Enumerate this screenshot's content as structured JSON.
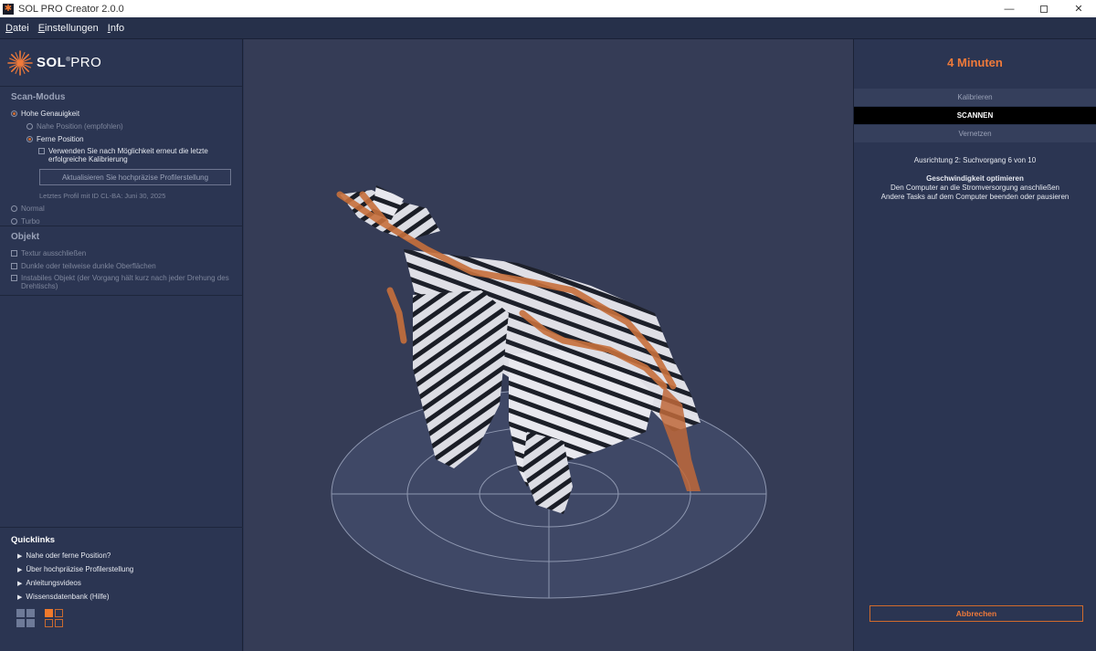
{
  "window": {
    "title": "SOL PRO Creator 2.0.0",
    "minimize": "—",
    "close": "✕"
  },
  "menu": [
    {
      "first": "D",
      "rest": "atei"
    },
    {
      "first": "E",
      "rest": "instellungen"
    },
    {
      "first": "I",
      "rest": "nfo"
    }
  ],
  "logo": {
    "sol": "SOL",
    "reg": "®",
    "pro": "PRO"
  },
  "scan_mode": {
    "heading": "Scan-Modus",
    "high_accuracy": "Hohe Genauigkeit",
    "near_position": "Nahe Position (empfohlen)",
    "far_position": "Ferne Position",
    "reuse_calibration": "Verwenden Sie nach Möglichkeit erneut die letzte erfolgreiche Kalibrierung",
    "update_profile_button": "Aktualisieren Sie hochpräzise Profilerstellung",
    "last_profile": "Letztes Profil mit ID CL-BA: Juni 30, 2025",
    "normal": "Normal",
    "turbo": "Turbo"
  },
  "object": {
    "heading": "Objekt",
    "exclude_texture": "Textur ausschließen",
    "dark_surfaces": "Dunkle oder teilweise dunkle Oberflächen",
    "unstable_object": "Instabiles Objekt (der Vorgang hält kurz nach jeder Drehung des Drehtischs)"
  },
  "quicklinks": {
    "heading": "Quicklinks",
    "items": [
      "Nahe oder ferne Position?",
      "Über hochpräzise Profilerstellung",
      "Anleitungsvideos",
      "Wissensdatenbank (Hilfe)"
    ]
  },
  "right_panel": {
    "timer": "4 Minuten",
    "steps": [
      "Kalibrieren",
      "SCANNEN",
      "Vernetzen"
    ],
    "active_step": "SCANNEN",
    "status_line": "Ausrichtung 2: Suchvorgang 6 von 10",
    "tip_title": "Geschwindigkeit optimieren",
    "tip_line1": "Den Computer an die Stromversorgung anschließen",
    "tip_line2": "Andere Tasks auf dem Computer beenden oder pausieren",
    "cancel_button": "Abbrechen"
  },
  "colors": {
    "accent": "#f07a3a",
    "panel_bg": "#2b3552",
    "viewport_bg": "#353c56"
  },
  "icons": [
    "app-logo-icon",
    "sol-star-icon",
    "arrow-right-icon",
    "layout-grid-icon",
    "layout-split-icon"
  ]
}
